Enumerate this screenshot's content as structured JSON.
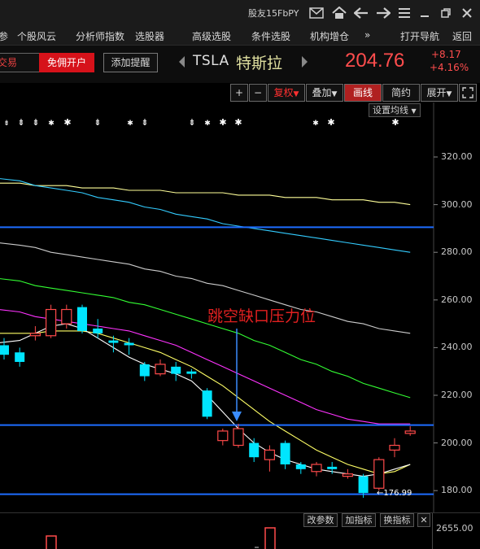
{
  "window": {
    "title": "股友15FbPY"
  },
  "menu": {
    "items": [
      "参",
      "个股风云",
      "分析师指数",
      "选股器",
      "高级选股",
      "条件选股",
      "机构增仓",
      "»",
      "打开导航",
      "返回"
    ]
  },
  "quote": {
    "trade_label": "交易",
    "open_account_label": "免佣开户",
    "add_alert_label": "添加提醒",
    "ticker": "TSLA",
    "name": "特斯拉",
    "price": "204.76",
    "change": "+8.17",
    "change_pct": "+4.16%"
  },
  "toolbar": {
    "plus": "+",
    "minus": "−",
    "adjust": "复权",
    "overlay": "叠加",
    "draw": "画线",
    "simple": "简约",
    "expand": "展开"
  },
  "chart": {
    "set_ma_label": "设置均线",
    "annotation": "跳空缺口压力位",
    "low_label": "176.99",
    "colors": {
      "up": "#ff4a4a",
      "down": "#00e5ff",
      "ma5": "#ffffff",
      "ma10": "#ffff66",
      "ma20": "#ff33ff",
      "ma30": "#33ff33",
      "ma60": "#cccccc",
      "ma120": "#33ccff",
      "ma250": "#ffff99",
      "hline": "#1e6cff"
    }
  },
  "chart_data": {
    "type": "candlestick",
    "y_ticks": [
      "320.00",
      "300.00",
      "280.00",
      "260.00",
      "240.00",
      "220.00",
      "200.00",
      "180.00"
    ],
    "ylim": [
      175,
      335
    ],
    "reference_lines": [
      290.5,
      207.5,
      178.5
    ],
    "candles": [
      {
        "open": 241,
        "close": 237,
        "high": 244,
        "low": 235
      },
      {
        "open": 238,
        "close": 234,
        "high": 240,
        "low": 232
      },
      {
        "open": 245,
        "close": 246,
        "high": 249,
        "low": 243
      },
      {
        "open": 245,
        "close": 256,
        "high": 258,
        "low": 244
      },
      {
        "open": 250,
        "close": 256,
        "high": 258,
        "low": 248
      },
      {
        "open": 257,
        "close": 247,
        "high": 258,
        "low": 246
      },
      {
        "open": 248,
        "close": 246,
        "high": 252,
        "low": 244
      },
      {
        "open": 243,
        "close": 242,
        "high": 245,
        "low": 238
      },
      {
        "open": 242,
        "close": 241,
        "high": 244,
        "low": 237
      },
      {
        "open": 233,
        "close": 228,
        "high": 234,
        "low": 226
      },
      {
        "open": 229,
        "close": 233,
        "high": 235,
        "low": 228
      },
      {
        "open": 232,
        "close": 229,
        "high": 234,
        "low": 226
      },
      {
        "open": 230,
        "close": 229,
        "high": 231,
        "low": 227
      },
      {
        "open": 222,
        "close": 211,
        "high": 223,
        "low": 210
      },
      {
        "open": 201,
        "close": 205,
        "high": 206,
        "low": 199
      },
      {
        "open": 199,
        "close": 206,
        "high": 208,
        "low": 198
      },
      {
        "open": 200,
        "close": 194,
        "high": 202,
        "low": 192
      },
      {
        "open": 193,
        "close": 197,
        "high": 199,
        "low": 188
      },
      {
        "open": 200,
        "close": 191,
        "high": 201,
        "low": 189
      },
      {
        "open": 191,
        "close": 189,
        "high": 192,
        "low": 187
      },
      {
        "open": 188,
        "close": 191,
        "high": 192,
        "low": 186
      },
      {
        "open": 190,
        "close": 189,
        "high": 192,
        "low": 187
      },
      {
        "open": 186,
        "close": 187,
        "high": 189,
        "low": 185
      },
      {
        "open": 186,
        "close": 179,
        "high": 187,
        "low": 177
      },
      {
        "open": 181,
        "close": 193,
        "high": 194,
        "low": 180
      },
      {
        "open": 197,
        "close": 199,
        "high": 202,
        "low": 194
      },
      {
        "open": 204,
        "close": 205,
        "high": 207,
        "low": 203
      }
    ],
    "moving_averages": {
      "ma5": [
        242,
        243,
        246,
        249,
        250,
        248,
        244,
        240,
        236,
        233,
        231,
        229,
        226,
        220,
        213,
        206,
        200,
        196,
        193,
        191,
        189,
        188,
        187,
        186,
        187,
        189,
        191
      ],
      "ma10": [
        246,
        246,
        246,
        247,
        247,
        247,
        246,
        244,
        242,
        240,
        238,
        235,
        232,
        228,
        224,
        219,
        214,
        209,
        205,
        201,
        197,
        194,
        191,
        189,
        187,
        188,
        191
      ],
      "ma20": [
        256,
        255,
        253,
        252,
        251,
        250,
        249,
        248,
        247,
        245,
        243,
        241,
        238,
        235,
        232,
        229,
        226,
        223,
        220,
        217,
        214,
        212,
        210,
        209,
        208,
        208,
        208
      ],
      "ma30": [
        269,
        268,
        266,
        265,
        264,
        263,
        262,
        261,
        259,
        258,
        256,
        254,
        252,
        250,
        248,
        246,
        243,
        241,
        238,
        235,
        233,
        230,
        228,
        225,
        223,
        221,
        219
      ],
      "ma60": [
        284,
        283,
        282,
        280,
        279,
        278,
        277,
        276,
        275,
        273,
        272,
        270,
        269,
        267,
        266,
        264,
        262,
        260,
        258,
        256,
        255,
        253,
        251,
        250,
        248,
        247,
        246
      ],
      "ma120": [
        311,
        310,
        308,
        307,
        306,
        305,
        303,
        302,
        301,
        299,
        298,
        296,
        295,
        294,
        292,
        291,
        290,
        289,
        288,
        287,
        286,
        285,
        284,
        283,
        282,
        281,
        280
      ],
      "ma250": [
        309,
        309,
        308,
        308,
        308,
        307,
        307,
        307,
        306,
        306,
        306,
        305,
        305,
        305,
        305,
        304,
        304,
        304,
        303,
        303,
        303,
        302,
        302,
        302,
        301,
        301,
        300
      ]
    }
  },
  "subpanel": {
    "change_params": "改参数",
    "add_indicator": "加指标",
    "switch_indicator": "换指标",
    "close": "✕",
    "y_label": "2655.00"
  }
}
